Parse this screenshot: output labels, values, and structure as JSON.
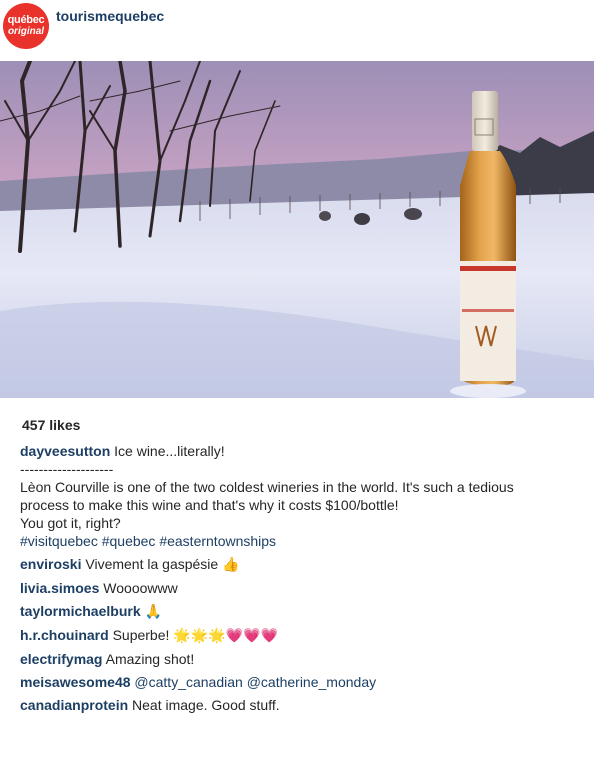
{
  "header": {
    "account": "tourismequebec",
    "avatar_line1": "québec",
    "avatar_line2": "original"
  },
  "post": {
    "likes": "457 likes",
    "caption": {
      "user": "dayveesutton",
      "text": "Ice wine...literally!",
      "divider": "--------------------",
      "body": "Lèon Courville is one of the two coldest wineries in the world. It's such a tedious\nprocess to make this wine and that's why it costs $100/bottle!\nYou got it, right?",
      "hashtags": "#visitquebec #quebec #easterntownships"
    },
    "comments": [
      {
        "user": "enviroski",
        "text": "Vivement la gaspésie",
        "emoji": "👍"
      },
      {
        "user": "livia.simoes",
        "text": "Woooowww",
        "emoji": ""
      },
      {
        "user": "taylormichaelburk",
        "text": "",
        "emoji": "🙏"
      },
      {
        "user": "h.r.chouinard",
        "text": "Superbe!",
        "emoji": "🌟🌟🌟💗💗💗"
      },
      {
        "user": "electrifymag",
        "text": "Amazing shot!",
        "emoji": ""
      },
      {
        "user": "meisawesome48",
        "text": "@catty_canadian @catherine_monday",
        "emoji": ""
      },
      {
        "user": "canadianprotein",
        "text": "Neat image. Good stuff.",
        "emoji": ""
      }
    ]
  },
  "colors": {
    "username": "#1d3f64",
    "avatar_bg": "#e8322b",
    "text": "#262626"
  }
}
